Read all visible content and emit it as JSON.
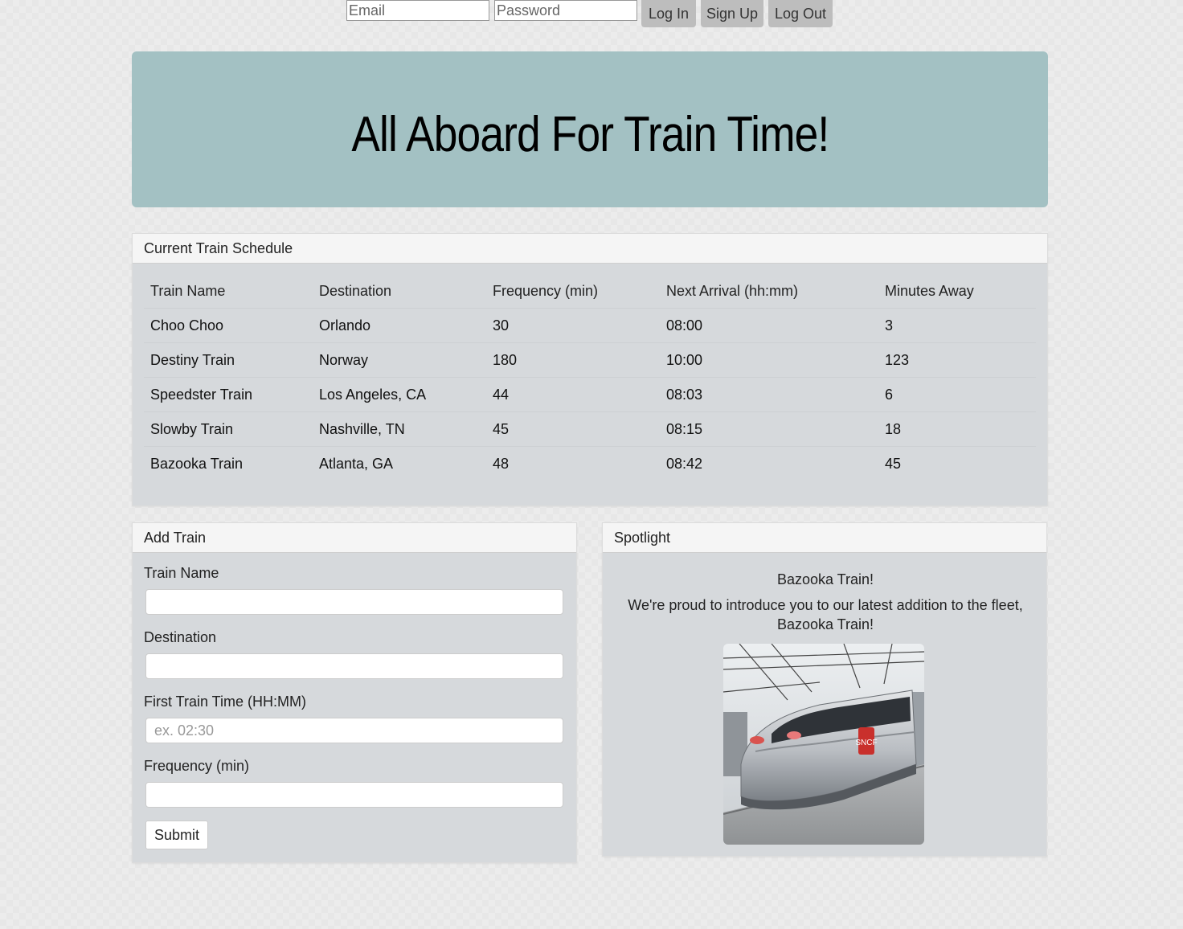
{
  "auth": {
    "email_placeholder": "Email",
    "password_placeholder": "Password",
    "login_label": "Log In",
    "signup_label": "Sign Up",
    "logout_label": "Log Out"
  },
  "header": {
    "title": "All Aboard For Train Time!"
  },
  "schedule": {
    "heading": "Current Train Schedule",
    "columns": [
      "Train Name",
      "Destination",
      "Frequency (min)",
      "Next Arrival (hh:mm)",
      "Minutes Away"
    ],
    "rows": [
      [
        "Choo Choo",
        "Orlando",
        "30",
        "08:00",
        "3"
      ],
      [
        "Destiny Train",
        "Norway",
        "180",
        "10:00",
        "123"
      ],
      [
        "Speedster Train",
        "Los Angeles, CA",
        "44",
        "08:03",
        "6"
      ],
      [
        "Slowby Train",
        "Nashville, TN",
        "45",
        "08:15",
        "18"
      ],
      [
        "Bazooka Train",
        "Atlanta, GA",
        "48",
        "08:42",
        "45"
      ]
    ]
  },
  "add_train": {
    "heading": "Add Train",
    "name_label": "Train Name",
    "destination_label": "Destination",
    "first_time_label": "First Train Time (HH:MM)",
    "first_time_placeholder": "ex. 02:30",
    "frequency_label": "Frequency (min)",
    "submit_label": "Submit"
  },
  "spotlight": {
    "heading": "Spotlight",
    "title": "Bazooka Train!",
    "description": "We're proud to introduce you to our latest addition to the fleet, Bazooka Train!",
    "image_badge": "SNCF"
  },
  "colors": {
    "jumbotron": "#a3c1c3",
    "panel_body": "#d6d9dc",
    "panel_heading": "#f5f5f5",
    "auth_button": "#bdbdbd"
  }
}
